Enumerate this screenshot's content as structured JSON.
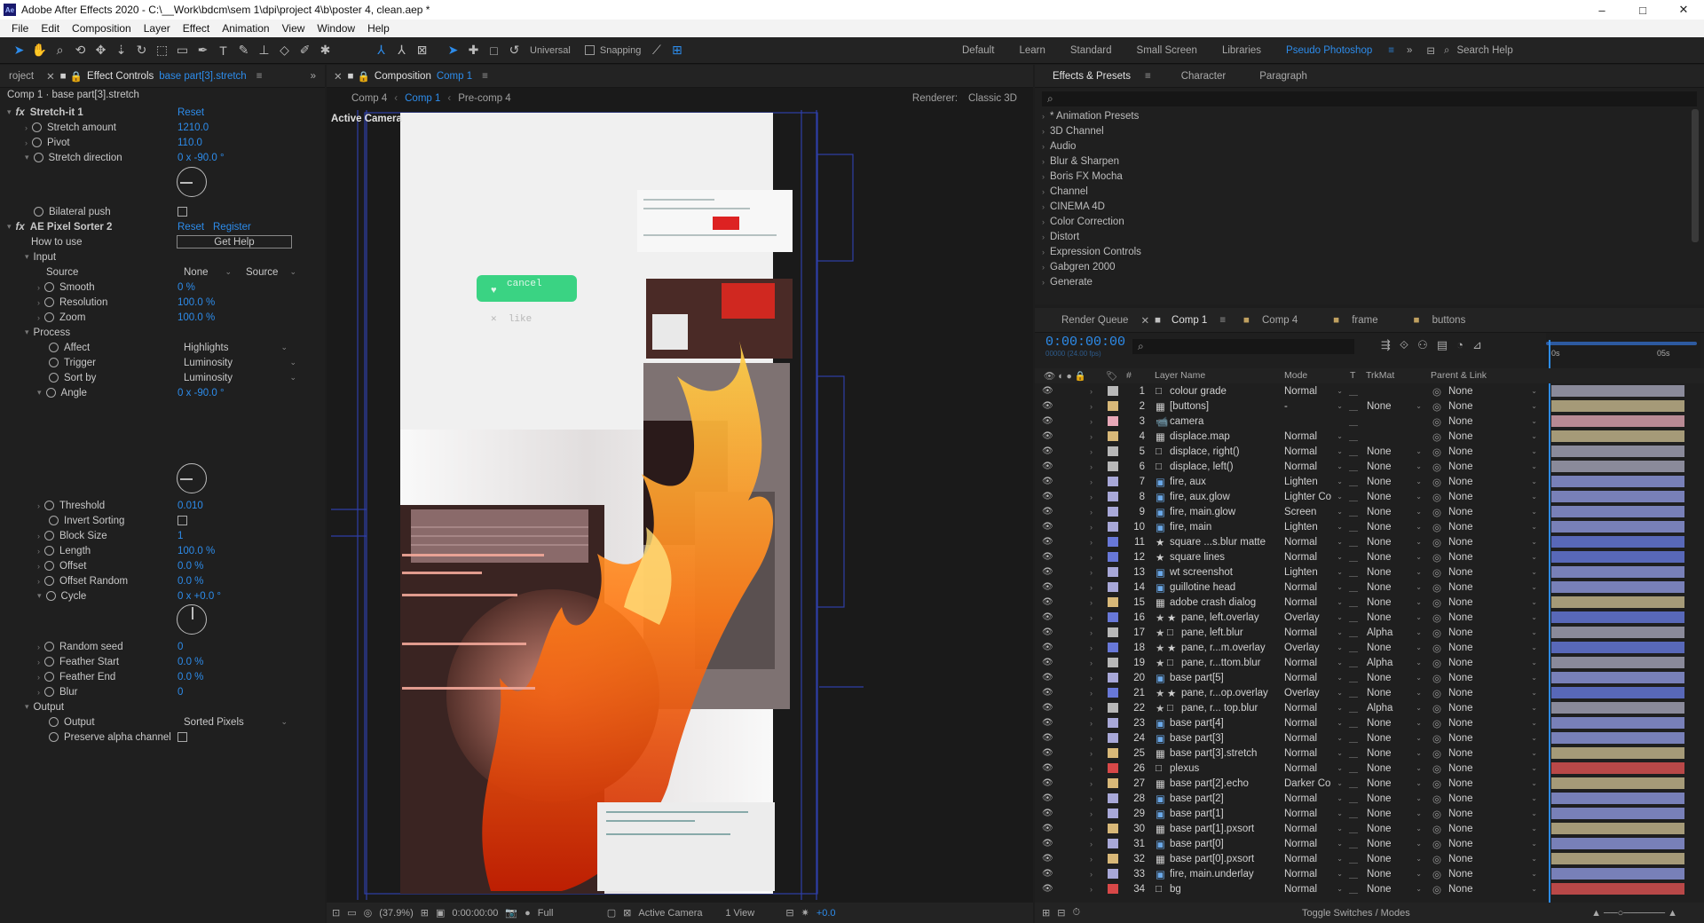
{
  "window": {
    "title": "Adobe After Effects 2020 - C:\\__Work\\bdcm\\sem 1\\dpi\\project 4\\b\\poster 4, clean.aep *",
    "controls": [
      "–",
      "□",
      "✕"
    ]
  },
  "menu": [
    "File",
    "Edit",
    "Composition",
    "Layer",
    "Effect",
    "Animation",
    "View",
    "Window",
    "Help"
  ],
  "toolbar": {
    "universal": "Universal",
    "snapping": "Snapping"
  },
  "workspaces": [
    "Default",
    "Learn",
    "Standard",
    "Small Screen",
    "Libraries",
    "Pseudo Photoshop"
  ],
  "search_help": "Search Help",
  "effect_controls": {
    "project_tab": "roject",
    "tab_label": "Effect Controls",
    "tab_layer": "base part[3].stretch",
    "header": "Comp 1 · base part[3].stretch",
    "stretch": {
      "name": "Stretch-it 1",
      "reset": "Reset",
      "props": [
        {
          "label": "Stretch amount",
          "value": "1210.0"
        },
        {
          "label": "Pivot",
          "value": "110.0"
        },
        {
          "label": "Stretch direction",
          "value": "0 x -90.0 °"
        }
      ],
      "bilateral": "Bilateral push"
    },
    "pixel_sorter": {
      "name": "AE Pixel Sorter 2",
      "reset": "Reset",
      "register": "Register",
      "how_to_use": "How to use",
      "get_help": "Get Help",
      "input": "Input",
      "source_label": "Source",
      "source_value": "None",
      "source_value2": "Source",
      "smooth": {
        "label": "Smooth",
        "value": "0 %"
      },
      "resolution": {
        "label": "Resolution",
        "value": "100.0 %"
      },
      "zoom": {
        "label": "Zoom",
        "value": "100.0 %"
      },
      "process": "Process",
      "affect": {
        "label": "Affect",
        "value": "Highlights"
      },
      "trigger": {
        "label": "Trigger",
        "value": "Luminosity"
      },
      "sort_by": {
        "label": "Sort by",
        "value": "Luminosity"
      },
      "angle": {
        "label": "Angle",
        "value": "0 x -90.0 °"
      },
      "threshold": {
        "label": "Threshold",
        "value": "0.010"
      },
      "invert": "Invert Sorting",
      "block_size": {
        "label": "Block Size",
        "value": "1"
      },
      "length": {
        "label": "Length",
        "value": "100.0 %"
      },
      "offset": {
        "label": "Offset",
        "value": "0.0 %"
      },
      "offset_random": {
        "label": "Offset Random",
        "value": "0.0 %"
      },
      "cycle": {
        "label": "Cycle",
        "value": "0 x +0.0 °"
      },
      "random_seed": {
        "label": "Random seed",
        "value": "0"
      },
      "feather_start": {
        "label": "Feather Start",
        "value": "0.0 %"
      },
      "feather_end": {
        "label": "Feather End",
        "value": "0.0 %"
      },
      "blur": {
        "label": "Blur",
        "value": "0"
      },
      "output_group": "Output",
      "output": {
        "label": "Output",
        "value": "Sorted Pixels"
      },
      "preserve": "Preserve alpha channel"
    }
  },
  "composition": {
    "tab_label": "Composition",
    "tab_comp": "Comp 1",
    "breadcrumbs": [
      "Comp 4",
      "Comp 1",
      "Pre-comp 4"
    ],
    "renderer_label": "Renderer:",
    "renderer": "Classic 3D",
    "active_camera": "Active Camera",
    "poster": {
      "cancel": "cancel",
      "like": "like"
    },
    "footer": {
      "zoom": "(37.9%)",
      "time": "0:00:00:00",
      "quality": "Full",
      "camera": "Active Camera",
      "views": "1 View",
      "exposure": "+0.0"
    }
  },
  "effects_presets": {
    "tabs": [
      "Effects & Presets",
      "Character",
      "Paragraph"
    ],
    "items": [
      "* Animation Presets",
      "3D Channel",
      "Audio",
      "Blur & Sharpen",
      "Boris FX Mocha",
      "Channel",
      "CINEMA 4D",
      "Color Correction",
      "Distort",
      "Expression Controls",
      "Gabgren 2000",
      "Generate"
    ]
  },
  "timeline": {
    "tabs": [
      "Render Queue",
      "Comp 1",
      "Comp 4",
      "frame",
      "buttons"
    ],
    "timecode": "0:00:00:00",
    "timecode_sub": "00000 (24.00 fps)",
    "headers": {
      "layer_name": "Layer Name",
      "mode": "Mode",
      "t": "T",
      "trkmat": "TrkMat",
      "parent": "Parent & Link"
    },
    "ruler": [
      "0s",
      "05s"
    ],
    "footer": "Toggle Switches / Modes",
    "layers": [
      {
        "n": "1",
        "name": "colour grade",
        "mode": "Normal",
        "trk": "",
        "parent": "None",
        "label": "#b8b8b8",
        "bar": "#8a8a9a",
        "type": "solid"
      },
      {
        "n": "2",
        "name": "[buttons]",
        "mode": "-",
        "trk": "None",
        "parent": "None",
        "label": "#d8b878",
        "bar": "#a59a78",
        "type": "comp"
      },
      {
        "n": "3",
        "name": "camera",
        "mode": "",
        "trk": "",
        "parent": "None",
        "label": "#e8a8b8",
        "bar": "#b88a94",
        "type": "camera"
      },
      {
        "n": "4",
        "name": "displace.map",
        "mode": "Normal",
        "trk": "",
        "parent": "None",
        "label": "#d8b878",
        "bar": "#a59a78",
        "type": "comp"
      },
      {
        "n": "5",
        "name": "displace, right()",
        "mode": "Normal",
        "trk": "None",
        "parent": "None",
        "label": "#b8b8b8",
        "bar": "#8a8a9a",
        "type": "solid"
      },
      {
        "n": "6",
        "name": "displace, left()",
        "mode": "Normal",
        "trk": "None",
        "parent": "None",
        "label": "#b8b8b8",
        "bar": "#8a8a9a",
        "type": "solid"
      },
      {
        "n": "7",
        "name": "fire, aux",
        "mode": "Lighten",
        "trk": "None",
        "parent": "None",
        "label": "#a8a8d8",
        "bar": "#7880b8",
        "type": "file"
      },
      {
        "n": "8",
        "name": "fire, aux.glow",
        "mode": "Lighter Co",
        "trk": "None",
        "parent": "None",
        "label": "#a8a8d8",
        "bar": "#7880b8",
        "type": "file"
      },
      {
        "n": "9",
        "name": "fire, main.glow",
        "mode": "Screen",
        "trk": "None",
        "parent": "None",
        "label": "#a8a8d8",
        "bar": "#7880b8",
        "type": "file"
      },
      {
        "n": "10",
        "name": "fire, main",
        "mode": "Lighten",
        "trk": "None",
        "parent": "None",
        "label": "#a8a8d8",
        "bar": "#7880b8",
        "type": "file"
      },
      {
        "n": "11",
        "name": "square ...s.blur matte",
        "mode": "Normal",
        "trk": "None",
        "parent": "None",
        "label": "#6878d8",
        "bar": "#5868b8",
        "type": "shape"
      },
      {
        "n": "12",
        "name": "square lines",
        "mode": "Normal",
        "trk": "None",
        "parent": "None",
        "label": "#6878d8",
        "bar": "#5868b8",
        "type": "shape"
      },
      {
        "n": "13",
        "name": "wt screenshot",
        "mode": "Lighten",
        "trk": "None",
        "parent": "None",
        "label": "#a8a8d8",
        "bar": "#7880b8",
        "type": "file"
      },
      {
        "n": "14",
        "name": "guillotine head",
        "mode": "Normal",
        "trk": "None",
        "parent": "None",
        "label": "#a8a8d8",
        "bar": "#7880b8",
        "type": "file"
      },
      {
        "n": "15",
        "name": "adobe crash dialog",
        "mode": "Normal",
        "trk": "None",
        "parent": "None",
        "label": "#d8b878",
        "bar": "#a59a78",
        "type": "comp"
      },
      {
        "n": "16",
        "name": "pane, left.overlay",
        "mode": "Overlay",
        "trk": "None",
        "parent": "None",
        "label": "#6878d8",
        "bar": "#5868b8",
        "type": "shape3d"
      },
      {
        "n": "17",
        "name": "pane, left.blur",
        "mode": "Normal",
        "trk": "Alpha",
        "parent": "None",
        "label": "#b8b8b8",
        "bar": "#8a8a9a",
        "type": "solid3d"
      },
      {
        "n": "18",
        "name": "pane, r...m.overlay",
        "mode": "Overlay",
        "trk": "None",
        "parent": "None",
        "label": "#6878d8",
        "bar": "#5868b8",
        "type": "shape3d"
      },
      {
        "n": "19",
        "name": "pane, r...ttom.blur",
        "mode": "Normal",
        "trk": "Alpha",
        "parent": "None",
        "label": "#b8b8b8",
        "bar": "#8a8a9a",
        "type": "solid3d"
      },
      {
        "n": "20",
        "name": "base part[5]",
        "mode": "Normal",
        "trk": "None",
        "parent": "None",
        "label": "#a8a8d8",
        "bar": "#7880b8",
        "type": "file"
      },
      {
        "n": "21",
        "name": "pane, r...op.overlay",
        "mode": "Overlay",
        "trk": "None",
        "parent": "None",
        "label": "#6878d8",
        "bar": "#5868b8",
        "type": "shape3d"
      },
      {
        "n": "22",
        "name": "pane, r... top.blur",
        "mode": "Normal",
        "trk": "Alpha",
        "parent": "None",
        "label": "#b8b8b8",
        "bar": "#8a8a9a",
        "type": "solid3d"
      },
      {
        "n": "23",
        "name": "base part[4]",
        "mode": "Normal",
        "trk": "None",
        "parent": "None",
        "label": "#a8a8d8",
        "bar": "#7880b8",
        "type": "file"
      },
      {
        "n": "24",
        "name": "base part[3]",
        "mode": "Normal",
        "trk": "None",
        "parent": "None",
        "label": "#a8a8d8",
        "bar": "#7880b8",
        "type": "file"
      },
      {
        "n": "25",
        "name": "base part[3].stretch",
        "mode": "Normal",
        "trk": "None",
        "parent": "None",
        "label": "#d8b878",
        "bar": "#a59a78",
        "type": "comp"
      },
      {
        "n": "26",
        "name": "plexus",
        "mode": "Normal",
        "trk": "None",
        "parent": "None",
        "label": "#d84848",
        "bar": "#b84848",
        "type": "solid"
      },
      {
        "n": "27",
        "name": "base part[2].echo",
        "mode": "Darker Co",
        "trk": "None",
        "parent": "None",
        "label": "#d8b878",
        "bar": "#a59a78",
        "type": "comp"
      },
      {
        "n": "28",
        "name": "base part[2]",
        "mode": "Normal",
        "trk": "None",
        "parent": "None",
        "label": "#a8a8d8",
        "bar": "#7880b8",
        "type": "file"
      },
      {
        "n": "29",
        "name": "base part[1]",
        "mode": "Normal",
        "trk": "None",
        "parent": "None",
        "label": "#a8a8d8",
        "bar": "#7880b8",
        "type": "file"
      },
      {
        "n": "30",
        "name": "base part[1].pxsort",
        "mode": "Normal",
        "trk": "None",
        "parent": "None",
        "label": "#d8b878",
        "bar": "#a59a78",
        "type": "comp"
      },
      {
        "n": "31",
        "name": "base part[0]",
        "mode": "Normal",
        "trk": "None",
        "parent": "None",
        "label": "#a8a8d8",
        "bar": "#7880b8",
        "type": "file"
      },
      {
        "n": "32",
        "name": "base part[0].pxsort",
        "mode": "Normal",
        "trk": "None",
        "parent": "None",
        "label": "#d8b878",
        "bar": "#a59a78",
        "type": "comp"
      },
      {
        "n": "33",
        "name": "fire, main.underlay",
        "mode": "Normal",
        "trk": "None",
        "parent": "None",
        "label": "#a8a8d8",
        "bar": "#7880b8",
        "type": "file"
      },
      {
        "n": "34",
        "name": "bg",
        "mode": "Normal",
        "trk": "None",
        "parent": "None",
        "label": "#d84848",
        "bar": "#b84848",
        "type": "solid"
      }
    ]
  },
  "colors": {
    "accent": "#2d8ceb",
    "panel": "#1f1f1f",
    "timecode": "#e8a13a",
    "green_button": "#3ad383"
  }
}
